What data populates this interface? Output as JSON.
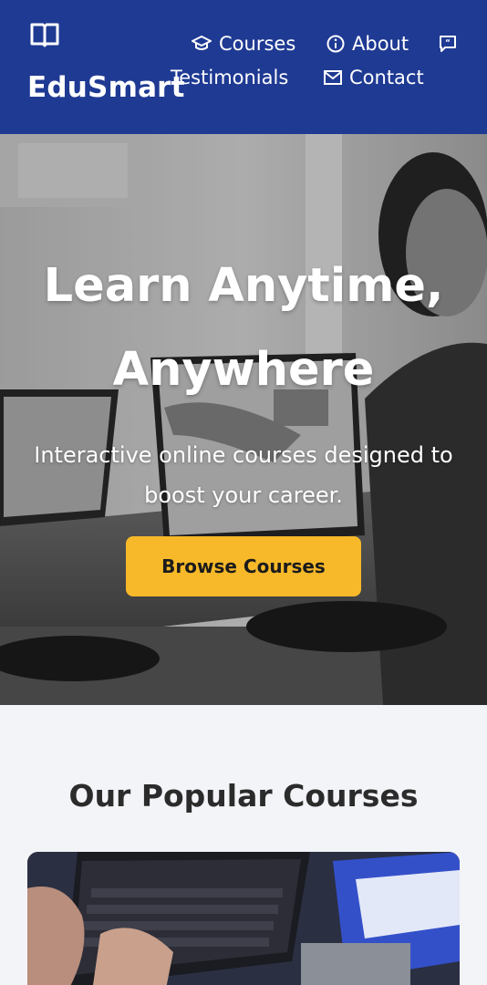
{
  "header": {
    "brand": "EduSmart",
    "logo_icon": "open-book-icon",
    "nav": [
      {
        "label": "Courses",
        "icon": "graduation-cap-icon"
      },
      {
        "label": "About",
        "icon": "info-circle-icon"
      },
      {
        "label": "Testimonials",
        "icon": "quote-bubble-icon"
      },
      {
        "label": "Contact",
        "icon": "envelope-icon"
      }
    ]
  },
  "hero": {
    "title_line1": "Learn Anytime,",
    "title_line2": "Anywhere",
    "subtitle": "Interactive online courses designed to boost your career.",
    "cta_label": "Browse Courses"
  },
  "popular": {
    "title": "Our Popular Courses"
  },
  "colors": {
    "header_bg": "#1f3a93",
    "cta_bg": "#f7b929",
    "page_bg": "#f3f4f8"
  }
}
